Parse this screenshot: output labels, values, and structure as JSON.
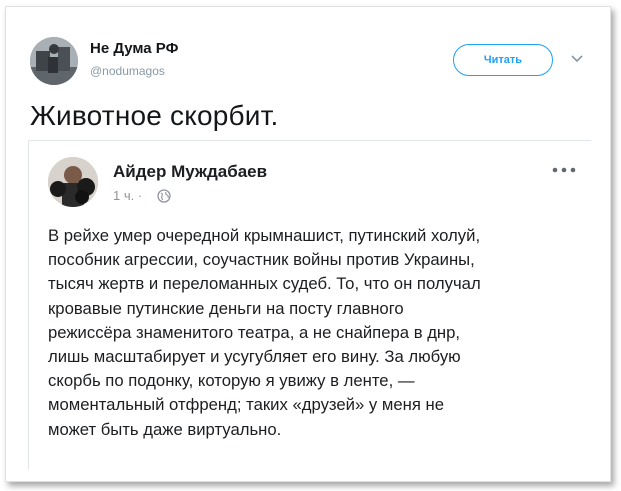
{
  "tweet": {
    "author_name": "Не Дума РФ",
    "author_handle": "@nodumagos",
    "follow_label": "Читать",
    "text": "Животное скорбит."
  },
  "embedded_post": {
    "author_name": "Айдер Муждабаев",
    "time": "1 ч. ·",
    "lines": [
      "В рейхе умер очередной крымнашист, путинский холуй,",
      "пособник агрессии, соучастник войны против Украины,",
      "тысяч жертв и переломанных судеб. То, что он получал",
      "кровавые путинские деньги на посту главного",
      "режиссёра знаменитого театра, а не снайпера в днр,",
      "лишь масштабирует и усугубляет его вину. За любую",
      "скорбь по подонку, которую я увижу в ленте, —",
      "моментальный отфренд; таких «друзей» у меня не",
      "может быть даже виртуально."
    ]
  },
  "icons": {
    "chevron": "chevron-down-icon",
    "globe": "globe-icon",
    "more": "more-options-icon"
  },
  "colors": {
    "accent": "#1da1f2",
    "text": "#14171a",
    "muted": "#8899a6"
  }
}
